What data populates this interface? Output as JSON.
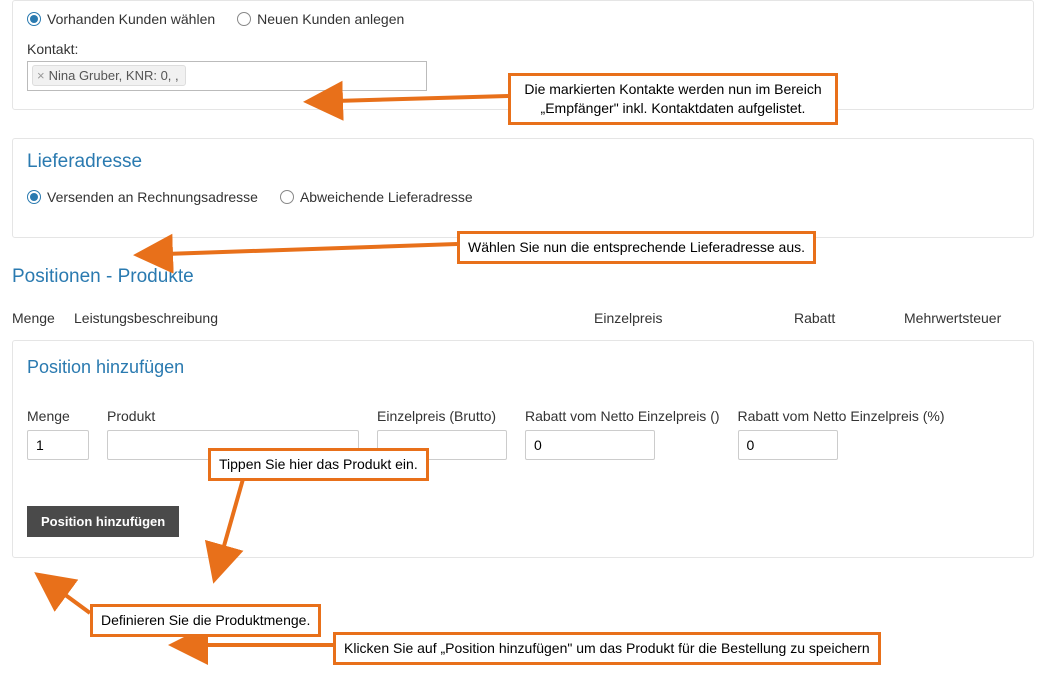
{
  "colors": {
    "orange": "#e8701a",
    "blue": "#2a7ab0"
  },
  "empfaenger": {
    "radios": {
      "existing": "Vorhanden Kunden wählen",
      "new": "Neuen Kunden anlegen"
    },
    "kontakt_label": "Kontakt:",
    "tag": "Nina Gruber, KNR: 0, ,"
  },
  "liefer": {
    "title": "Lieferadresse",
    "radios": {
      "billing": "Versenden an Rechnungsadresse",
      "other": "Abweichende Lieferadresse"
    }
  },
  "positionen": {
    "title": "Positionen - Produkte",
    "headers": {
      "menge": "Menge",
      "desc": "Leistungsbeschreibung",
      "price": "Einzelpreis",
      "rabatt": "Rabatt",
      "vat": "Mehrwertsteuer"
    }
  },
  "add_pos": {
    "title": "Position hinzufügen",
    "labels": {
      "menge": "Menge",
      "produkt": "Produkt",
      "price": "Einzelpreis (Brutto)",
      "rabatt_abs": "Rabatt vom Netto Einzelpreis ()",
      "rabatt_pct": "Rabatt vom Netto Einzelpreis (%)"
    },
    "values": {
      "menge": "1",
      "produkt": "",
      "price": "",
      "rabatt_abs": "0",
      "rabatt_pct": "0"
    },
    "button": "Position hinzufügen"
  },
  "callouts": {
    "c1": "Die markierten Kontakte werden nun im Bereich „Empfänger\" inkl. Kontaktdaten aufgelistet.",
    "c2": "Wählen Sie nun die entsprechende Lieferadresse aus.",
    "c3": "Tippen Sie hier das Produkt ein.",
    "c4": "Definieren Sie die Produktmenge.",
    "c5": "Klicken Sie auf „Position hinzufügen\" um das Produkt für die Bestellung zu speichern"
  }
}
